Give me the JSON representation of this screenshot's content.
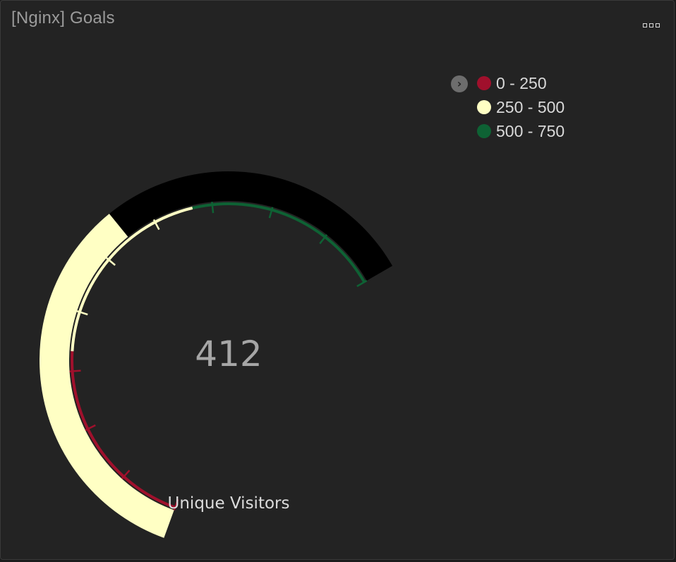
{
  "panel": {
    "title": "[Nginx] Goals"
  },
  "icons": {
    "menu": "more-options-icon",
    "legend_toggle": "chevron-right-icon"
  },
  "legend": {
    "toggle_glyph": "›",
    "items": [
      {
        "label": "0 - 250",
        "color": "#a0102c"
      },
      {
        "label": "250 - 500",
        "color": "#ffffc4"
      },
      {
        "label": "500 - 750",
        "color": "#0e6234"
      }
    ]
  },
  "chart_data": {
    "type": "gauge",
    "value": 412,
    "value_text": "412",
    "label": "Unique Visitors",
    "min": 0,
    "max": 750,
    "ranges": [
      {
        "from": 0,
        "to": 250,
        "color": "#a0102c"
      },
      {
        "from": 250,
        "to": 500,
        "color": "#ffffc4"
      },
      {
        "from": 500,
        "to": 750,
        "color": "#0e6234"
      }
    ],
    "fill_color": "#ffffc4",
    "track_color": "#000000",
    "tick_count": 11
  }
}
